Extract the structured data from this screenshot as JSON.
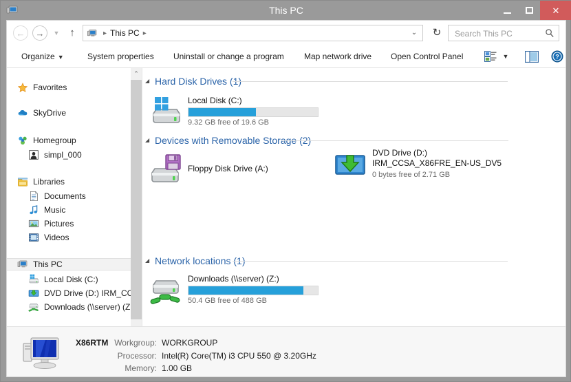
{
  "window": {
    "title": "This PC",
    "title_icon": "this-pc-icon",
    "minimize_label": "Minimize",
    "maximize_label": "Maximize",
    "close_label": "Close",
    "close_glyph": "✕"
  },
  "address_bar": {
    "back_glyph": "←",
    "forward_glyph": "→",
    "history_glyph": "▼",
    "up_glyph": "↑",
    "breadcrumb_icon": "this-pc-icon",
    "breadcrumb": "This PC",
    "separator": "▸",
    "dropdown_glyph": "⌄",
    "refresh_glyph": "↻"
  },
  "search": {
    "placeholder": "Search This PC",
    "value": "",
    "icon": "search-icon"
  },
  "toolbar": {
    "organize": "Organize",
    "organize_caret": "▼",
    "system_properties": "System properties",
    "uninstall": "Uninstall or change a program",
    "map_network_drive": "Map network drive",
    "open_control_panel": "Open Control Panel",
    "view_caret": "▼"
  },
  "navigation_pane": {
    "items": [
      {
        "label": "Favorites",
        "icon": "star-icon",
        "indent": 14,
        "selected": false
      },
      {
        "label": "SkyDrive",
        "icon": "cloud-icon",
        "indent": 14,
        "selected": false
      },
      {
        "label": "Homegroup",
        "icon": "homegroup-icon",
        "indent": 14,
        "selected": false
      },
      {
        "label": "simpl_000",
        "icon": "user-icon",
        "indent": 30,
        "selected": false
      },
      {
        "label": "Libraries",
        "icon": "library-icon",
        "indent": 14,
        "selected": false
      },
      {
        "label": "Documents",
        "icon": "documents-icon",
        "indent": 30,
        "selected": false
      },
      {
        "label": "Music",
        "icon": "music-icon",
        "indent": 30,
        "selected": false
      },
      {
        "label": "Pictures",
        "icon": "pictures-icon",
        "indent": 30,
        "selected": false
      },
      {
        "label": "Videos",
        "icon": "videos-icon",
        "indent": 30,
        "selected": false
      },
      {
        "label": "This PC",
        "icon": "this-pc-icon",
        "indent": 14,
        "selected": true
      },
      {
        "label": "Local Disk (C:)",
        "icon": "hard-disk-icon",
        "indent": 30,
        "selected": false
      },
      {
        "label": "DVD Drive (D:) IRM_CCS",
        "icon": "dvd-drive-icon",
        "indent": 30,
        "selected": false
      },
      {
        "label": "Downloads (\\\\server) (Z",
        "icon": "network-drive-icon",
        "indent": 30,
        "selected": false
      }
    ],
    "scroll_up_glyph": "⌃",
    "scroll_down_glyph": "⌄"
  },
  "content": {
    "collapse_glyph": "◢",
    "groups": [
      {
        "title": "Hard Disk Drives (1)",
        "items": [
          {
            "name": "Local Disk (C:)",
            "icon": "hard-disk-icon",
            "sub": "9.32 GB free of 19.6 GB",
            "has_bar": true,
            "used_percent": 52
          }
        ]
      },
      {
        "title": "Devices with Removable Storage (2)",
        "items": [
          {
            "name": "Floppy Disk Drive (A:)",
            "icon": "floppy-drive-icon",
            "sub": "",
            "has_bar": false,
            "used_percent": 0
          },
          {
            "name": "DVD Drive (D:)",
            "name2": "IRM_CCSA_X86FRE_EN-US_DV5",
            "icon": "dvd-drive-icon",
            "sub": "0 bytes free of 2.71 GB",
            "has_bar": false,
            "used_percent": 100
          }
        ]
      },
      {
        "title": "Network locations (1)",
        "items": [
          {
            "name": "Downloads (\\\\server) (Z:)",
            "icon": "network-drive-icon",
            "sub": "50.4 GB free of 488 GB",
            "has_bar": true,
            "used_percent": 89
          }
        ]
      }
    ]
  },
  "details_pane": {
    "computer_name": "X86RTM",
    "icon": "computer-icon",
    "rows": [
      {
        "label": "Workgroup:",
        "value": "WORKGROUP"
      },
      {
        "label": "Processor:",
        "value": "Intel(R) Core(TM) i3 CPU      550  @ 3.20GHz"
      },
      {
        "label": "Memory:",
        "value": "1.00 GB"
      }
    ]
  },
  "colors": {
    "accent_blue": "#26a0da",
    "group_header": "#2a63a8",
    "close_button": "#d15b5b",
    "titlebar": "#9a9a9a"
  }
}
